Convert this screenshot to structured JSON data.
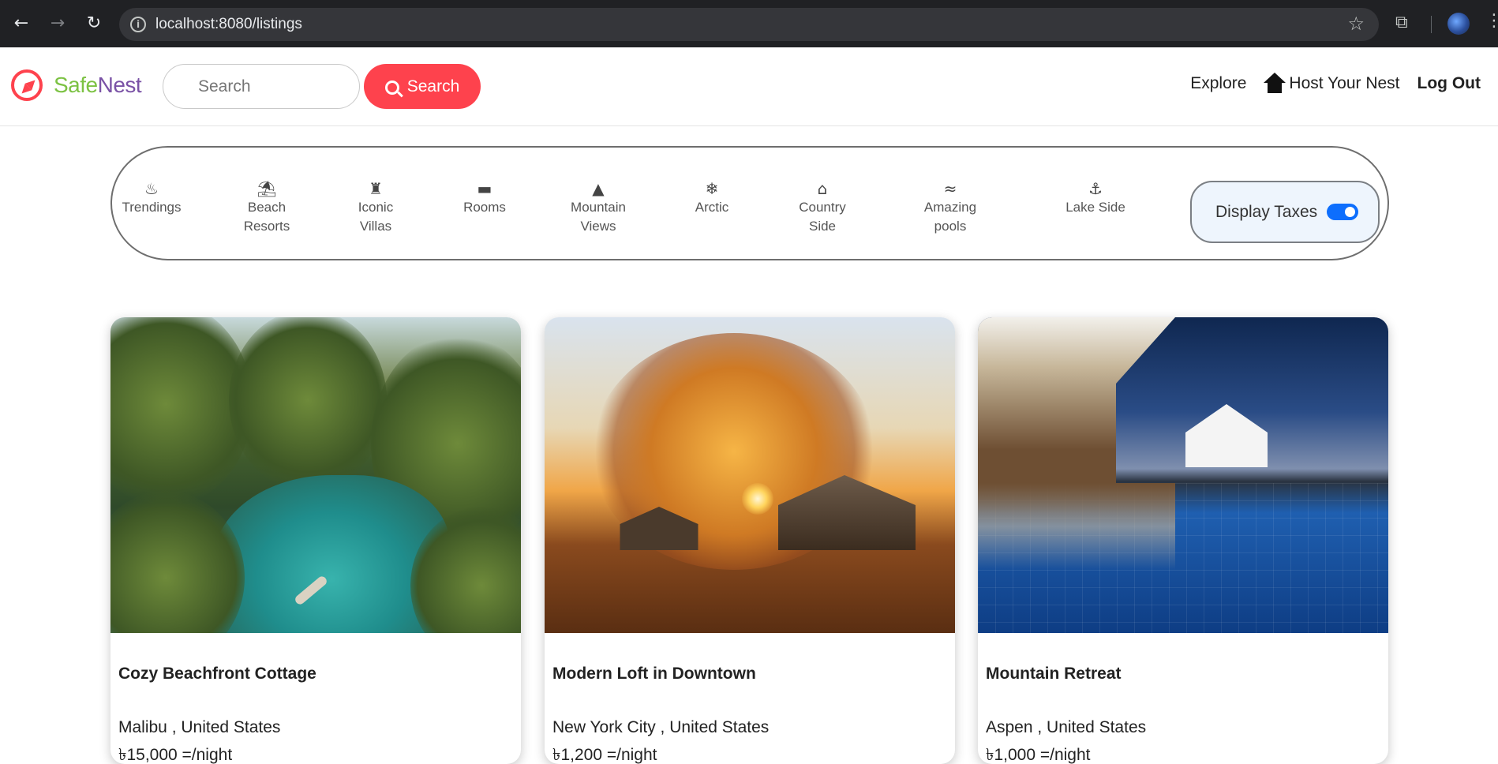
{
  "browser": {
    "url": "localhost:8080/listings"
  },
  "navbar": {
    "brand_part1": "Safe",
    "brand_part2": "Nest",
    "search_placeholder": "Search",
    "search_button": "Search",
    "links": {
      "explore": "Explore",
      "host": "Host Your Nest",
      "logout": "Log Out"
    }
  },
  "filters": [
    {
      "icon": "fire-icon",
      "line1": "Trendings",
      "line2": ""
    },
    {
      "icon": "umbrella-beach-icon",
      "line1": "Beach",
      "line2": "Resorts"
    },
    {
      "icon": "castle-icon",
      "line1": "Iconic",
      "line2": "Villas"
    },
    {
      "icon": "bed-icon",
      "line1": "Rooms",
      "line2": ""
    },
    {
      "icon": "mountain-icon",
      "line1": "Mountain",
      "line2": "Views"
    },
    {
      "icon": "snowflake-icon",
      "line1": "Arctic",
      "line2": ""
    },
    {
      "icon": "house-icon",
      "line1": "Country",
      "line2": "Side"
    },
    {
      "icon": "swimmer-icon",
      "line1": "Amazing",
      "line2": "pools"
    },
    {
      "icon": "anchor-icon",
      "line1": "Lake Side",
      "line2": ""
    }
  ],
  "tax_toggle": {
    "label": "Display Taxes",
    "on": true
  },
  "listings": [
    {
      "title": "Cozy Beachfront Cottage",
      "location": "Malibu ,  United States",
      "price": "৳15,000 =/night"
    },
    {
      "title": "Modern Loft in Downtown",
      "location": "New York City ,  United States",
      "price": "৳1,200 =/night"
    },
    {
      "title": "Mountain Retreat",
      "location": "Aspen ,  United States",
      "price": "৳1,000 =/night"
    }
  ],
  "colors": {
    "accent": "#fe424d",
    "brand_safe": "#7cc243",
    "brand_nest": "#7a52a6",
    "toggle_on": "#0d6efd"
  }
}
